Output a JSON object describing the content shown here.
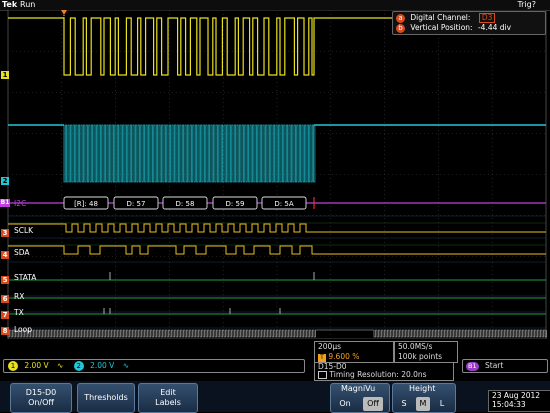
{
  "topbar": {
    "brand": "Tek",
    "status": "Run",
    "trig_status": "Trig?"
  },
  "info": {
    "channel_key": "a",
    "channel_label": "Digital Channel:",
    "channel_value": "D3",
    "position_key": "b",
    "position_label": "Vertical Position:",
    "position_value": "-4.44 div"
  },
  "channels": {
    "ch1_marker": "1",
    "ch2_marker": "2",
    "bus": {
      "marker": "B1",
      "name": "I2C",
      "packets": [
        "[R]: 48",
        "D: 57",
        "D: 58",
        "D: 59",
        "D: 5A"
      ]
    },
    "digital": [
      "SCLK",
      "SDA",
      "STATA",
      "RX",
      "TX",
      "Loop"
    ],
    "digital_markers": [
      "3",
      "4",
      "5",
      "6",
      "7",
      "8",
      "9"
    ]
  },
  "scale": {
    "ch1_num": "1",
    "ch1_value": "2.00 V",
    "ch2_num": "2",
    "ch2_value": "2.00 V",
    "bw_symbol": "∿"
  },
  "timebase": {
    "time_div": "200µs",
    "trig_pos": "9.600 %",
    "trig_pos_icon": "T"
  },
  "sampling": {
    "rate": "50.0MS/s",
    "points": "100k points"
  },
  "digital_info": {
    "title": "D15-D0",
    "timing_label": "Timing Resolution:",
    "timing_value": "20.0ns"
  },
  "trigger": {
    "badge": "B1",
    "label": "Start"
  },
  "buttons": {
    "d15": [
      "D15-D0",
      "On/Off"
    ],
    "thresholds": "Thresholds",
    "edit_labels": [
      "Edit",
      "Labels"
    ],
    "magnivu": {
      "label": "MagniVu",
      "on": "On",
      "off": "Off"
    },
    "height": {
      "label": "Height",
      "s": "S",
      "m": "M",
      "l": "L"
    }
  },
  "datetime": {
    "date": "23 Aug 2012",
    "time": "15:04:33"
  },
  "colors": {
    "ch1": "#e8e020",
    "ch2": "#20c8d8",
    "bus": "#c040e0",
    "digital_high": "#20c040",
    "accent": "#d84a1c"
  }
}
